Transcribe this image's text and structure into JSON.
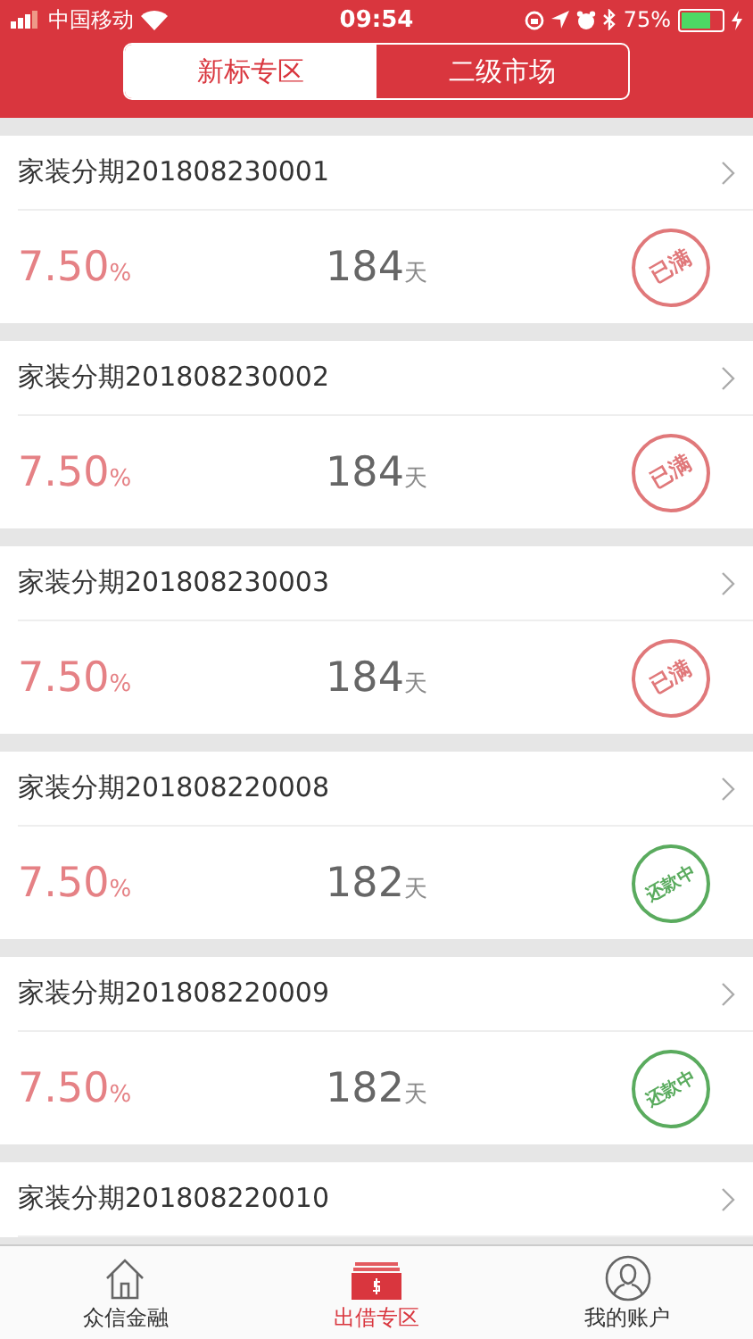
{
  "status_bar": {
    "carrier": "中国移动",
    "time": "09:54",
    "battery": "75%"
  },
  "segments": [
    {
      "label": "新标专区",
      "selected": true
    },
    {
      "label": "二级市场",
      "selected": false
    }
  ],
  "loans": [
    {
      "title": "家装分期201808230001",
      "rate": "7.50",
      "rate_unit": "%",
      "term": "184",
      "term_unit": "天",
      "status": {
        "kind": "full",
        "label": "已满"
      }
    },
    {
      "title": "家装分期201808230002",
      "rate": "7.50",
      "rate_unit": "%",
      "term": "184",
      "term_unit": "天",
      "status": {
        "kind": "full",
        "label": "已满"
      }
    },
    {
      "title": "家装分期201808230003",
      "rate": "7.50",
      "rate_unit": "%",
      "term": "184",
      "term_unit": "天",
      "status": {
        "kind": "full",
        "label": "已满"
      }
    },
    {
      "title": "家装分期201808220008",
      "rate": "7.50",
      "rate_unit": "%",
      "term": "182",
      "term_unit": "天",
      "status": {
        "kind": "repaying",
        "label": "还款中"
      }
    },
    {
      "title": "家装分期201808220009",
      "rate": "7.50",
      "rate_unit": "%",
      "term": "182",
      "term_unit": "天",
      "status": {
        "kind": "repaying",
        "label": "还款中"
      }
    },
    {
      "title": "家装分期201808220010"
    }
  ],
  "tab_bar": [
    {
      "label": "众信金融",
      "selected": false
    },
    {
      "label": "出借专区",
      "selected": true
    },
    {
      "label": "我的账户",
      "selected": false
    }
  ]
}
